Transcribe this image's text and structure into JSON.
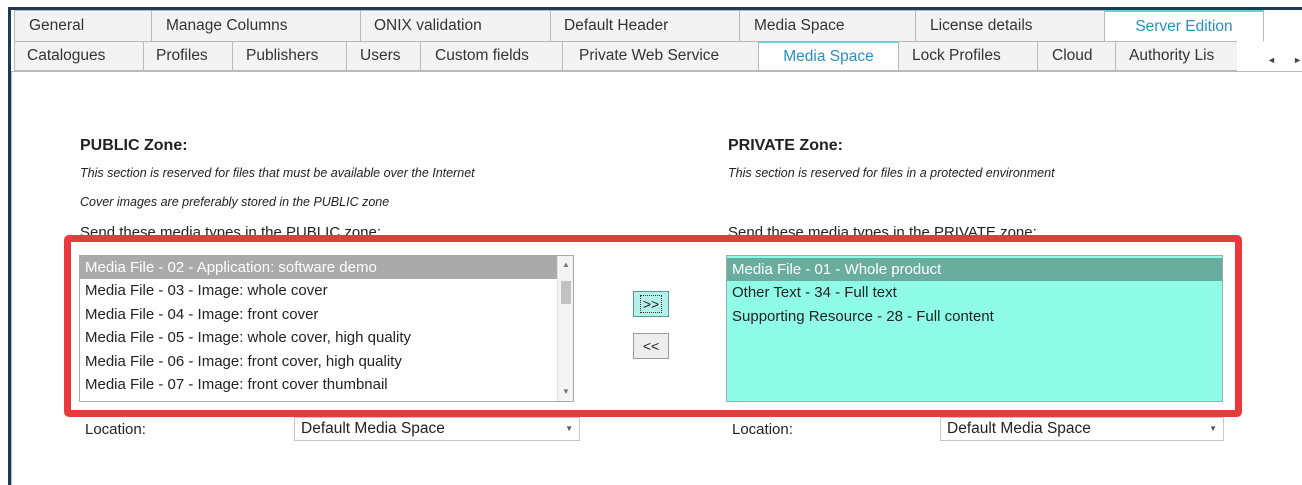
{
  "tabs_row1": [
    {
      "label": "General",
      "active": false
    },
    {
      "label": "Manage Columns",
      "active": false
    },
    {
      "label": "ONIX validation",
      "active": false
    },
    {
      "label": "Default Header",
      "active": false
    },
    {
      "label": "Media Space",
      "active": false
    },
    {
      "label": "License details",
      "active": false
    },
    {
      "label": "Server Edition",
      "active": true
    }
  ],
  "tabs_row2": [
    {
      "label": "Catalogues",
      "active": false
    },
    {
      "label": "Profiles",
      "active": false
    },
    {
      "label": "Publishers",
      "active": false
    },
    {
      "label": "Users",
      "active": false
    },
    {
      "label": "Custom fields",
      "active": false
    },
    {
      "label": "Private Web Service",
      "active": false
    },
    {
      "label": "Media Space",
      "active": true
    },
    {
      "label": "Lock Profiles",
      "active": false
    },
    {
      "label": "Cloud",
      "active": false
    },
    {
      "label": "Authority Lis",
      "active": false
    }
  ],
  "public": {
    "title": "PUBLIC Zone:",
    "desc1": "This section is reserved for files that must be available over the Internet",
    "desc2": "Cover images are preferably stored in the PUBLIC zone",
    "send_label": "Send these media types in the PUBLIC zone:",
    "items": [
      "Media File - 02 - Application: software demo",
      "Media File - 03 - Image: whole cover",
      "Media File - 04 - Image: front cover",
      "Media File - 05 - Image: whole cover, high quality",
      "Media File - 06 - Image: front cover, high quality",
      "Media File - 07 - Image: front cover thumbnail"
    ],
    "selected_index": 0,
    "location_label": "Location:",
    "location_value": "Default Media Space"
  },
  "private": {
    "title": "PRIVATE Zone:",
    "desc1": "This section is reserved for files in a protected environment",
    "send_label": "Send these media types in the PRIVATE zone:",
    "items": [
      "Media File - 01 - Whole product",
      "Other Text - 34 - Full text",
      "Supporting Resource - 28 - Full content"
    ],
    "selected_index": 0,
    "location_label": "Location:",
    "location_value": "Default Media Space"
  },
  "buttons": {
    "move_right": ">>",
    "move_left": "<<"
  },
  "icons": {
    "tab_scroll_left": "◄",
    "tab_scroll_right": "►",
    "scroll_up": "▲",
    "scroll_down": "▼",
    "dropdown": "▼"
  },
  "colors": {
    "active_tab_text": "#2a8fbf",
    "private_list_bg": "#8ffce8",
    "private_selected_bg": "#69ad9e",
    "public_selected_bg": "#aaaaaa",
    "highlight_border": "#e8393d"
  }
}
